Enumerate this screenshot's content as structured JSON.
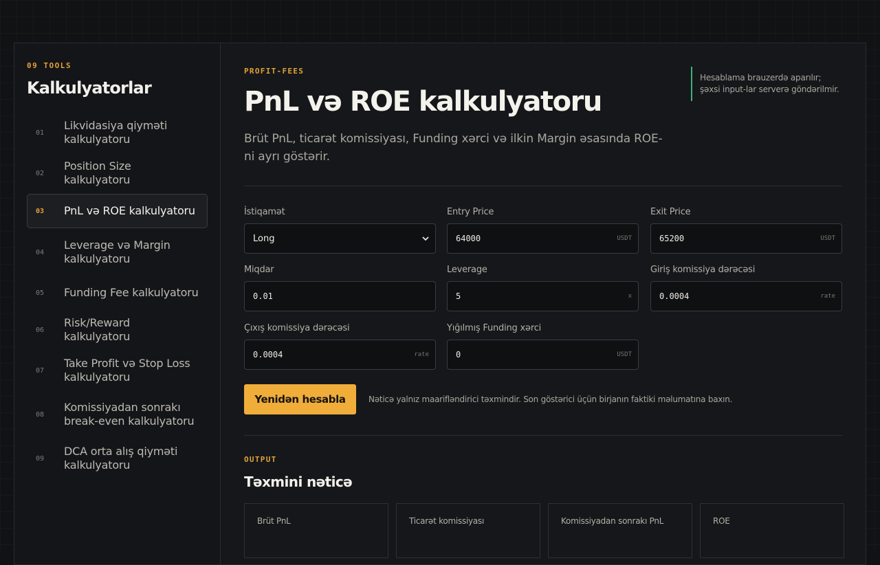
{
  "sidebar": {
    "kicker": "09 TOOLS",
    "title": "Kalkulyatorlar",
    "items": [
      {
        "num": "01",
        "label": "Likvidasiya qiyməti kalkulyatoru"
      },
      {
        "num": "02",
        "label": "Position Size kalkulyatoru"
      },
      {
        "num": "03",
        "label": "PnL və ROE kalkulyatoru"
      },
      {
        "num": "04",
        "label": "Leverage və Margin kalkulyatoru"
      },
      {
        "num": "05",
        "label": "Funding Fee kalkulyatoru"
      },
      {
        "num": "06",
        "label": "Risk/Reward kalkulyatoru"
      },
      {
        "num": "07",
        "label": "Take Profit və Stop Loss kalkulyatoru"
      },
      {
        "num": "08",
        "label": "Komissiyadan sonrakı break-even kalkulyatoru"
      },
      {
        "num": "09",
        "label": "DCA orta alış qiyməti kalkulyatoru"
      }
    ],
    "active_index": 2
  },
  "header": {
    "kicker": "PROFIT-FEES",
    "title": "PnL və ROE kalkulyatoru",
    "description": "Brüt PnL, ticarət komissiyası, Funding xərci və ilkin Margin əsasında ROE-ni ayrı göstərir.",
    "privacy_note": "Hesablama brauzerdə aparılır; şəxsi input-lar serverə göndərilmir."
  },
  "form": {
    "direction": {
      "label": "İstiqamət",
      "value": "Long"
    },
    "entry_price": {
      "label": "Entry Price",
      "value": "64000",
      "unit": "USDT"
    },
    "exit_price": {
      "label": "Exit Price",
      "value": "65200",
      "unit": "USDT"
    },
    "quantity": {
      "label": "Miqdar",
      "value": "0.01",
      "unit": ""
    },
    "leverage": {
      "label": "Leverage",
      "value": "5",
      "unit": "x"
    },
    "entry_fee": {
      "label": "Giriş komissiya dərəcəsi",
      "value": "0.0004",
      "unit": "rate"
    },
    "exit_fee": {
      "label": "Çıxış komissiya dərəcəsi",
      "value": "0.0004",
      "unit": "rate"
    },
    "funding": {
      "label": "Yığılmış Funding xərci",
      "value": "0",
      "unit": "USDT"
    }
  },
  "actions": {
    "recalc_label": "Yenidən hesabla",
    "note": "Nəticə yalnız maarifləndirici təxmindir. Son göstərici üçün birjanın faktiki məlumatına baxın."
  },
  "output": {
    "kicker": "OUTPUT",
    "title": "Təxmini nəticə",
    "cards": [
      {
        "label": "Brüt PnL"
      },
      {
        "label": "Ticarət komissiyası"
      },
      {
        "label": "Komissiyadan sonrakı PnL"
      },
      {
        "label": "ROE"
      }
    ]
  },
  "colors": {
    "accent": "#f0ad3a",
    "kicker": "#e0a23a",
    "privacy_border": "#3db27a",
    "background": "#111214"
  }
}
